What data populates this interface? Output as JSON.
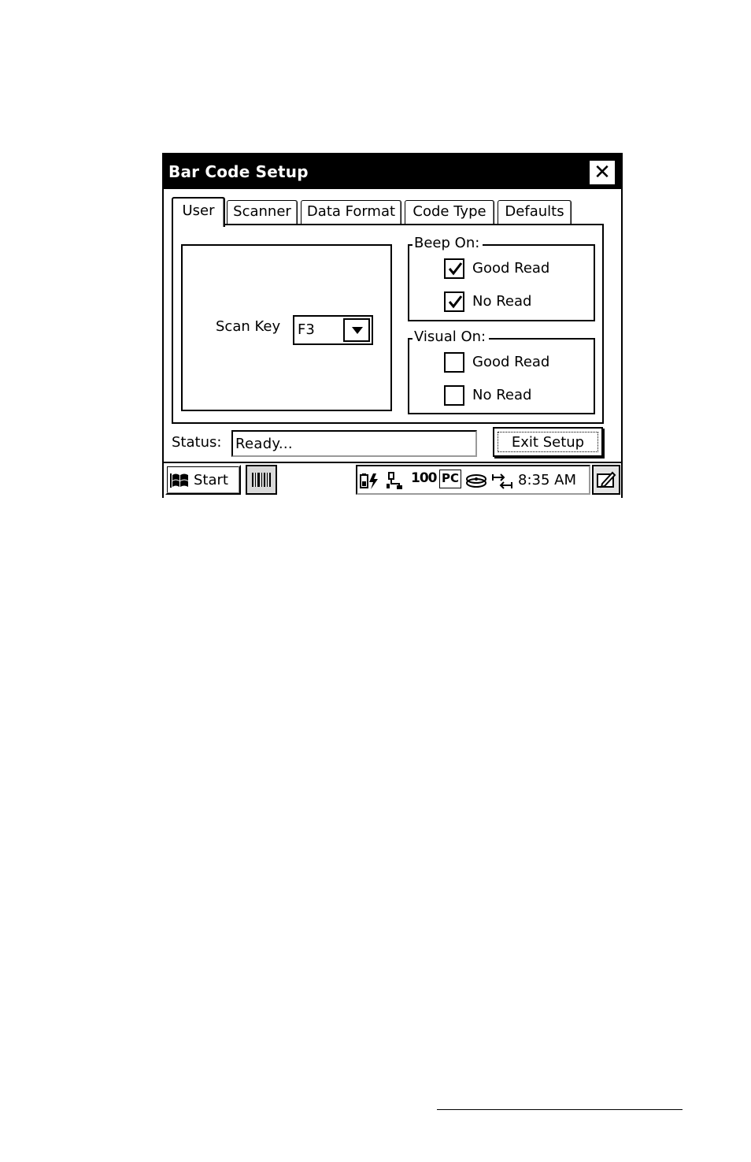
{
  "window": {
    "title": "Bar Code Setup",
    "close_glyph": "✕",
    "icons": {
      "close": "close-icon"
    }
  },
  "tabs": [
    {
      "label": "User",
      "active": true
    },
    {
      "label": "Scanner",
      "active": false
    },
    {
      "label": "Data Format",
      "active": false
    },
    {
      "label": "Code Type",
      "active": false
    },
    {
      "label": "Defaults",
      "active": false
    }
  ],
  "user_tab": {
    "scan_key": {
      "label": "Scan Key",
      "value": "F3"
    },
    "beep_on": {
      "legend": "Beep On:",
      "options": [
        {
          "label": "Good Read",
          "checked": true
        },
        {
          "label": "No Read",
          "checked": true
        }
      ]
    },
    "visual_on": {
      "legend": "Visual On:",
      "options": [
        {
          "label": "Good Read",
          "checked": false
        },
        {
          "label": "No Read",
          "checked": false
        }
      ]
    }
  },
  "status": {
    "label": "Status:",
    "value": "Ready..."
  },
  "exit_button": {
    "label": "Exit Setup"
  },
  "taskbar": {
    "start_label": "Start",
    "clock": "8:35 AM",
    "tray_text": {
      "pc": "PC",
      "signal": "100"
    },
    "icons": [
      "windows-flag-icon",
      "barcode-app-icon",
      "battery-icon",
      "network-icon",
      "signal-icon",
      "pc-icon",
      "disk-icon",
      "sync-icon",
      "input-panel-icon"
    ]
  }
}
